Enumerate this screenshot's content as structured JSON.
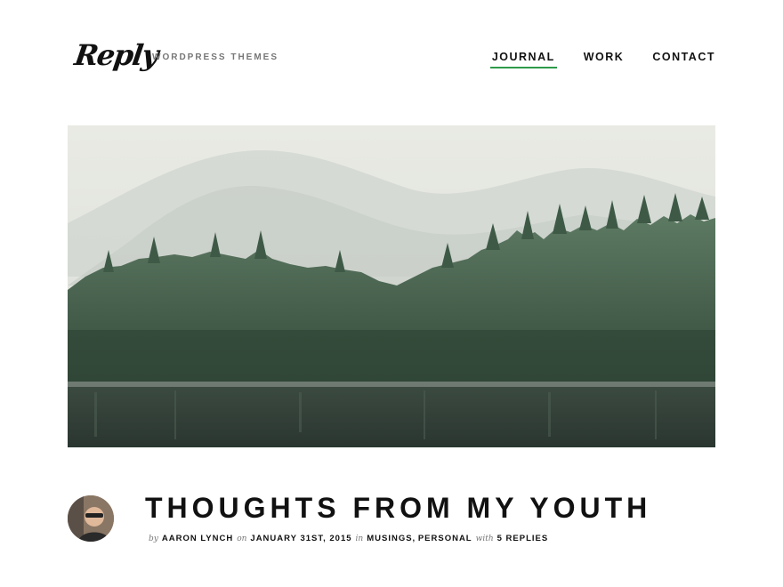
{
  "site": {
    "logo": "Reply",
    "tagline": "WORDPRESS THEMES"
  },
  "nav": {
    "items": [
      {
        "label": "JOURNAL",
        "active": true
      },
      {
        "label": "WORK",
        "active": false
      },
      {
        "label": "CONTACT",
        "active": false
      }
    ],
    "active_color": "#2e9a4a"
  },
  "hero": {
    "image": "misty-forest-lake-photo"
  },
  "post": {
    "title": "THOUGHTS FROM MY YOUTH",
    "by_word": "by",
    "author": "AARON LYNCH",
    "on_word": "on",
    "date": "JANUARY 31ST, 2015",
    "in_word": "in",
    "category_1": "MUSINGS",
    "separator": ",",
    "category_2": "PERSONAL",
    "with_word": "with",
    "replies": "5 REPLIES",
    "avatar": "author-avatar"
  }
}
